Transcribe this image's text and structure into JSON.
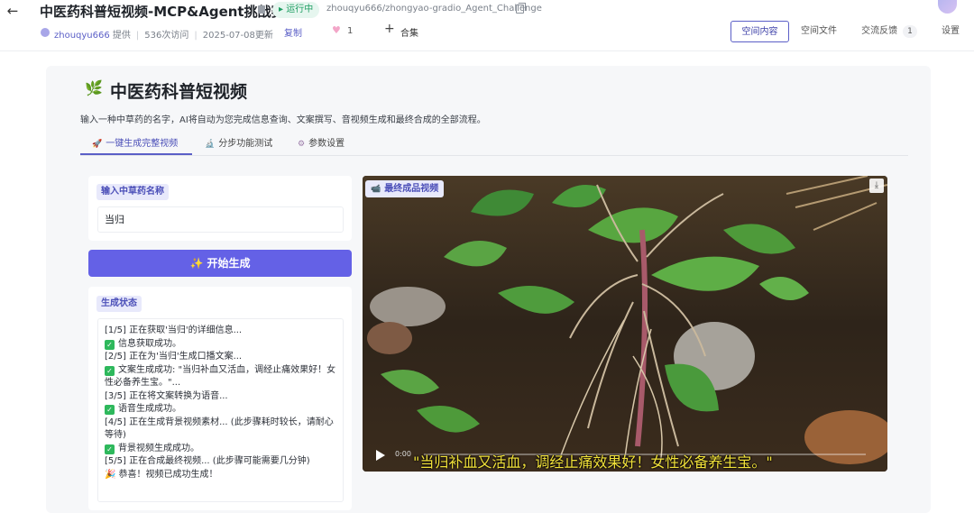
{
  "header": {
    "title": "中医药科普短视频-MCP&Agent挑战赛",
    "status": "运行中",
    "repo": "zhouqyu666/zhongyao-gradio_Agent_Challenge",
    "provider": "zhouqyu666",
    "provider_suffix": "提供",
    "visits": "536次访问",
    "updated": "2025-07-08更新",
    "copy_label": "复制",
    "likes": "1",
    "collect_label": "合集",
    "nav": {
      "space_content": "空间内容",
      "space_files": "空间文件",
      "feedback": "交流反馈",
      "feedback_count": "1",
      "settings": "设置"
    }
  },
  "app": {
    "title": "中医药科普短视频",
    "description": "输入一种中草药的名字，AI将自动为您完成信息查询、文案撰写、音视频生成和最终合成的全部流程。",
    "tabs": [
      {
        "label": "一键生成完整视频",
        "icon": "rocket-icon"
      },
      {
        "label": "分步功能测试",
        "icon": "microscope-icon"
      },
      {
        "label": "参数设置",
        "icon": "gear-icon"
      }
    ],
    "input_label": "输入中草药名称",
    "input_value": "当归",
    "generate_button": "开始生成",
    "status_label": "生成状态",
    "status_lines": [
      "[1/5] 正在获取'当归'的详细信息...",
      "信息获取成功。",
      "[2/5] 正在为'当归'生成口播文案...",
      "文案生成成功: \"当归补血又活血，调经止痛效果好！女性必备养生宝。\"...",
      "[3/5] 正在将文案转换为语音...",
      "语音生成成功。",
      "[4/5] 正在生成背景视频素材... (此步骤耗时较长，请耐心等待)",
      "背景视频生成成功。",
      "[5/5] 正在合成最终视频... (此步骤可能需要几分钟)",
      "恭喜！视频已成功生成！"
    ],
    "video_label": "最终成品视频",
    "video_time": "0:00",
    "subtitle": "\"当归补血又活血，调经止痛效果好！女性必备养生宝。\""
  }
}
